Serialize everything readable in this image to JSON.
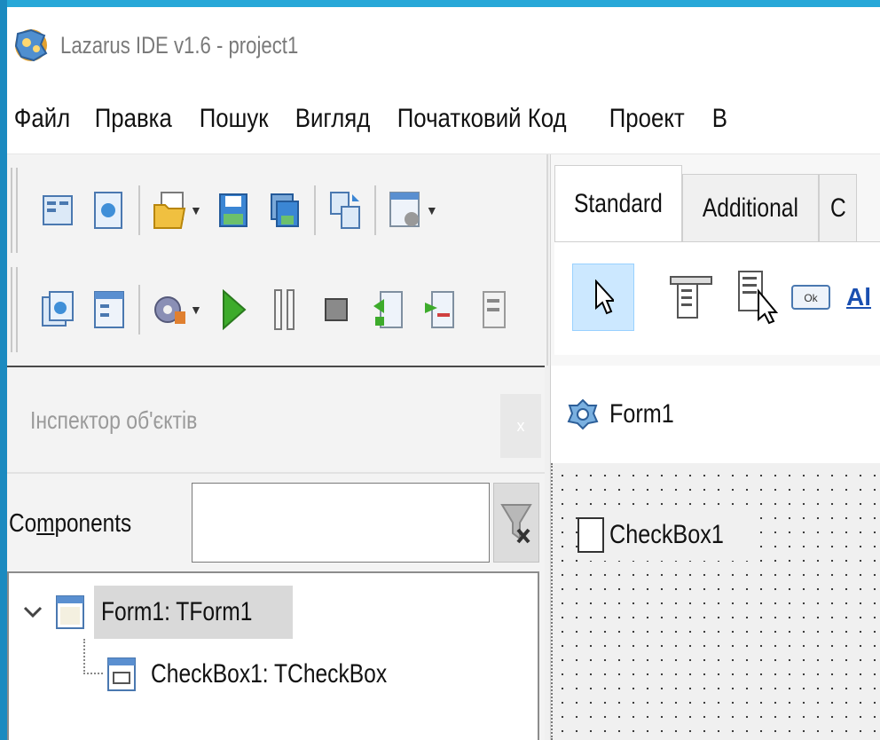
{
  "window": {
    "title": "Lazarus IDE v1.6 - project1"
  },
  "menu": {
    "items": [
      "Файл",
      "Правка",
      "Пошук",
      "Вигляд",
      "Початковий Код",
      "Проект",
      "В"
    ]
  },
  "palette": {
    "tabs": [
      "Standard",
      "Additional",
      "C"
    ],
    "partial_label": "Al"
  },
  "inspector": {
    "title": "Інспектор об'єктів",
    "close_label": "x",
    "components_label_prefix": "Co",
    "components_label_underlined": "m",
    "components_label_suffix": "ponents",
    "filter_value": "",
    "tree": [
      {
        "label": "Form1: TForm1",
        "expanded": true
      },
      {
        "label": "CheckBox1: TCheckBox"
      }
    ]
  },
  "designer": {
    "form_title": "Form1",
    "checkbox_label": "CheckBox1",
    "checkbox_checked": false
  },
  "colors": {
    "frame": "#2a8fc4",
    "selection": "#cce8ff",
    "run_green": "#3dab2b"
  }
}
